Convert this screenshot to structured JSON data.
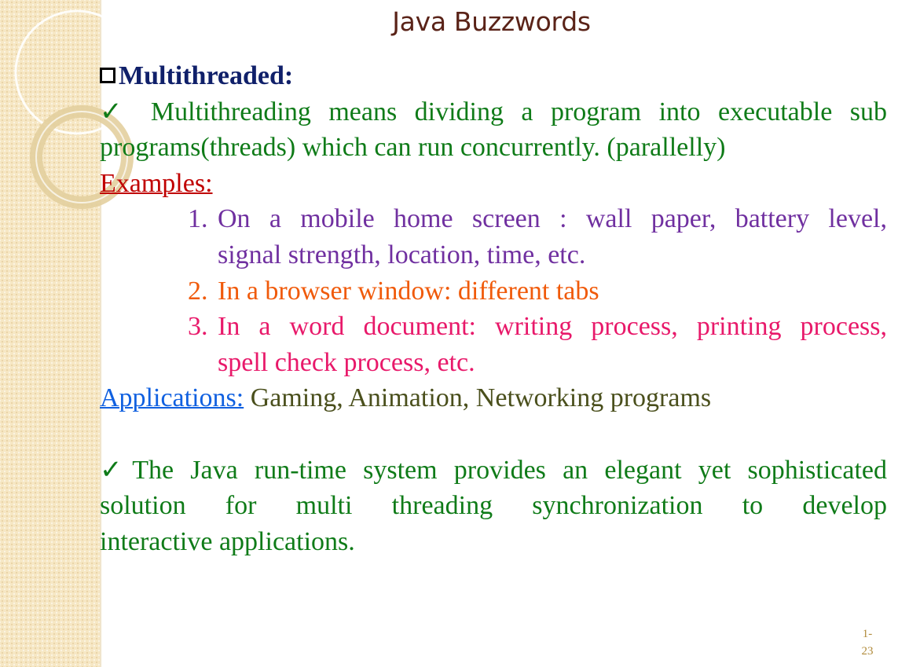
{
  "slide": {
    "title": "Java Buzzwords",
    "heading": "Multithreaded:",
    "intro": {
      "check": "✓",
      "line1": "Multithreading means dividing a program into executable sub",
      "line2": "programs(threads) which can run concurrently. (parallelly)"
    },
    "examples_label": "Examples:",
    "examples": [
      {
        "num": "1.",
        "line1": "On a  mobile home screen : wall paper, battery level,",
        "line2": "signal strength, location, time, etc."
      },
      {
        "num": "2.",
        "line1": "In a browser window: different tabs"
      },
      {
        "num": "3.",
        "line1": " In a word document: writing process, printing process,",
        "line2": "spell check process, etc."
      }
    ],
    "applications_label": "Applications:",
    "applications_text": " Gaming, Animation, Networking programs",
    "closing": {
      "check": "✓",
      "line1": "The Java run-time system provides an elegant yet  sophisticated",
      "line2": "solution for multi threading synchronization to develop",
      "line3": "interactive applications."
    },
    "page_number": "1-\n23"
  },
  "colors": {
    "title": "#5a2318",
    "heading": "#10206a",
    "body_green": "#0f7b18",
    "examples_label": "#c00000",
    "example1": "#7030a0",
    "example2": "#f05a0a",
    "example3": "#e8196a",
    "applications_label": "#1060e0",
    "applications_text": "#4a4f1c",
    "band": "#f6e7c4"
  }
}
